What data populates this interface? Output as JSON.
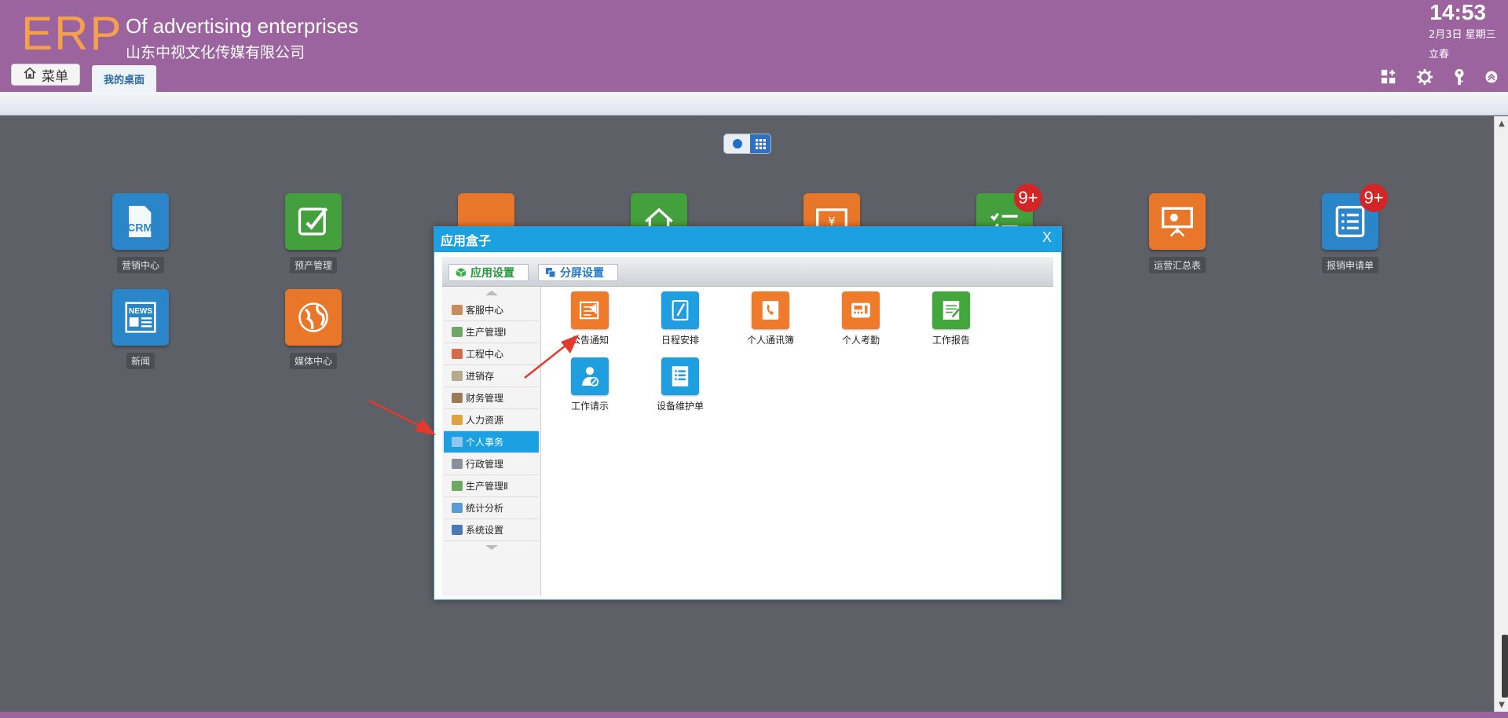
{
  "header": {
    "logo": "ERP",
    "company_en": "Of advertising enterprises",
    "company_cn": "山东中视文化传媒有限公司",
    "time": "14:53",
    "date": "2月3日 星期三",
    "solar_term": "立春",
    "menu_label": "菜单",
    "tab_label": "我的桌面",
    "icons": [
      "add-widget-icon",
      "gear-icon",
      "key-icon",
      "collapse-up-icon"
    ]
  },
  "desktop": {
    "apps": [
      {
        "label": "营销中心",
        "icon": "crm-icon",
        "color": "#2a86c8"
      },
      {
        "label": "预产管理",
        "icon": "edit-icon",
        "color": "#43a03c"
      },
      {
        "label": "",
        "icon": "people-icon",
        "color": "#e8772a"
      },
      {
        "label": "",
        "icon": "home-icon",
        "color": "#43a03c"
      },
      {
        "label": "",
        "icon": "yen-icon",
        "color": "#e8772a"
      },
      {
        "label": "",
        "icon": "checklist-icon",
        "color": "#43a03c",
        "badge": "9+"
      },
      {
        "label": "运营汇总表",
        "icon": "presentation-icon",
        "color": "#e8772a"
      },
      {
        "label": "报销申请单",
        "icon": "list-icon",
        "color": "#2a86c8",
        "badge": "9+"
      },
      {
        "label": "新闻",
        "icon": "news-icon",
        "color": "#2a86c8"
      },
      {
        "label": "媒体中心",
        "icon": "globe-icon",
        "color": "#e8772a"
      }
    ]
  },
  "modal": {
    "title": "应用盒子",
    "close": "X",
    "tabs": [
      {
        "label": "应用设置"
      },
      {
        "label": "分屏设置"
      }
    ],
    "categories": [
      {
        "label": "客服中心",
        "active": false
      },
      {
        "label": "生产管理Ⅰ",
        "active": false
      },
      {
        "label": "工程中心",
        "active": false
      },
      {
        "label": "进销存",
        "active": false
      },
      {
        "label": "财务管理",
        "active": false
      },
      {
        "label": "人力资源",
        "active": false
      },
      {
        "label": "个人事务",
        "active": true
      },
      {
        "label": "行政管理",
        "active": false
      },
      {
        "label": "生产管理Ⅱ",
        "active": false
      },
      {
        "label": "统计分析",
        "active": false
      },
      {
        "label": "系统设置",
        "active": false
      }
    ],
    "apps": [
      {
        "label": "公告通知",
        "icon": "notice-icon",
        "color": "#ee7a2a"
      },
      {
        "label": "日程安排",
        "icon": "notebook-icon",
        "color": "#1f9ee0"
      },
      {
        "label": "个人通讯簿",
        "icon": "phonebook-icon",
        "color": "#ee7a2a"
      },
      {
        "label": "个人考勤",
        "icon": "attendance-icon",
        "color": "#ee7a2a"
      },
      {
        "label": "工作报告",
        "icon": "report-icon",
        "color": "#43a83c"
      },
      {
        "label": "工作请示",
        "icon": "request-icon",
        "color": "#1f9ee0"
      },
      {
        "label": "设备维护单",
        "icon": "checklist-icon",
        "color": "#1f9ee0"
      }
    ]
  }
}
